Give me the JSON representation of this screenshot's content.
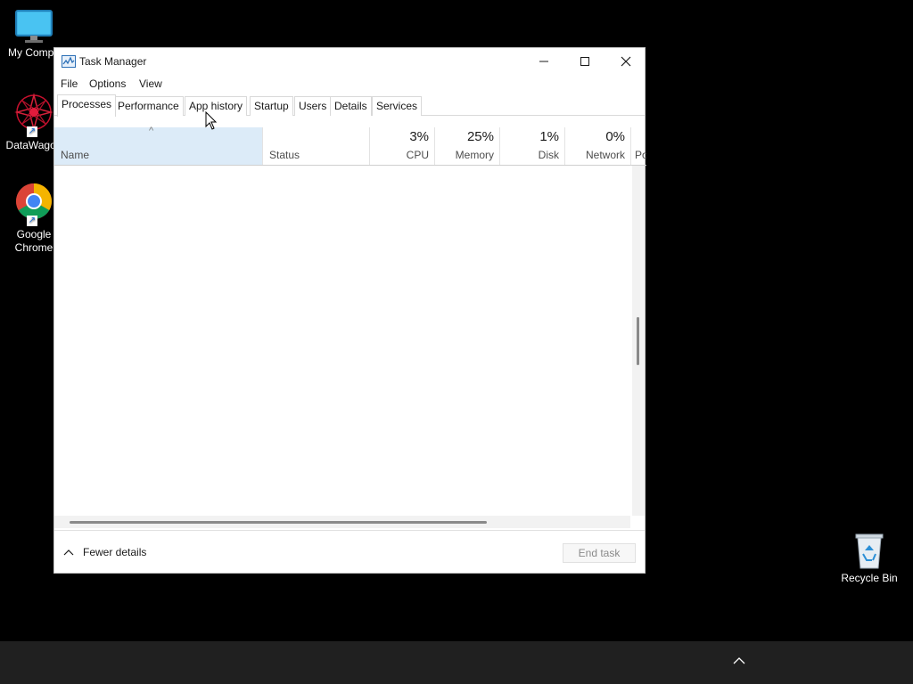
{
  "desktop": {
    "icons": [
      {
        "label": "My Compu",
        "icon": "monitor-icon"
      },
      {
        "label": "DataWagon",
        "icon": "datawagon-icon"
      },
      {
        "label": "Google Chrome",
        "label_line1": "Google",
        "label_line2": "Chrome",
        "icon": "chrome-icon"
      },
      {
        "label": "Recycle Bin",
        "icon": "recycle-bin-icon"
      }
    ]
  },
  "window": {
    "title": "Task Manager",
    "controls": {
      "minimize": "—",
      "maximize": "☐",
      "close": "✕"
    },
    "menu": [
      "File",
      "Options",
      "View"
    ],
    "tabs": [
      "Processes",
      "Performance",
      "App history",
      "Startup",
      "Users",
      "Details",
      "Services"
    ],
    "active_tab": "Processes",
    "columns": {
      "name": {
        "label": "Name"
      },
      "status": {
        "label": "Status"
      },
      "cpu": {
        "label": "CPU",
        "value": "3%"
      },
      "memory": {
        "label": "Memory",
        "value": "25%"
      },
      "disk": {
        "label": "Disk",
        "value": "1%"
      },
      "network": {
        "label": "Network",
        "value": "0%"
      },
      "power": {
        "label": "Po"
      }
    },
    "footer": {
      "fewer_details": "Fewer details",
      "end_task": "End task"
    }
  },
  "colors": {
    "desktop_bg": "#000000",
    "taskbar_bg": "#202020",
    "name_col_highlight": "#dcebf8"
  }
}
